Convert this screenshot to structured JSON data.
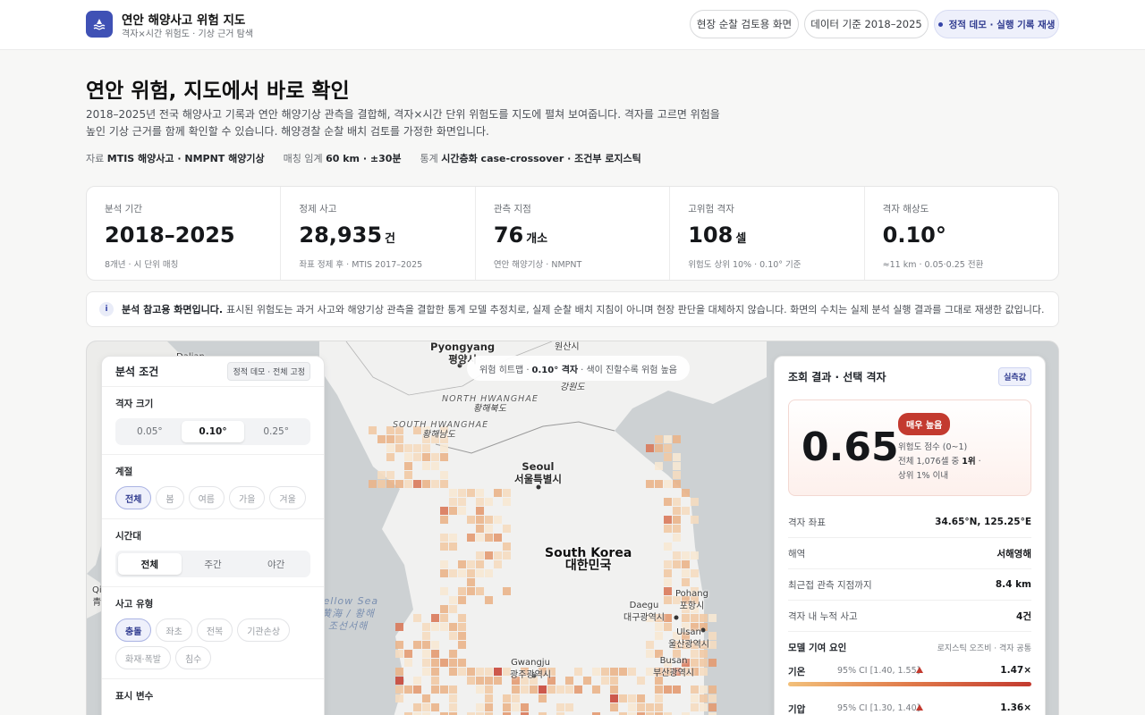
{
  "header": {
    "title": "연안 해양사고 위험 지도",
    "subtitle": "격자×시간 위험도 · 기상 근거 탐색",
    "buttons": [
      {
        "label": "현장 순찰 검토용 화면"
      },
      {
        "label": "데이터 기준 2018–2025"
      },
      {
        "label": "정적 데모 · 실행 기록 재생"
      }
    ]
  },
  "hero": {
    "title": "연안 위험, 지도에서 바로 확인",
    "description": "2018–2025년 전국 해양사고 기록과 연안 해양기상 관측을 결합해, 격자×시간 단위 위험도를 지도에 펼쳐 보여줍니다. 격자를 고르면 위험을 높인 기상 근거를 함께 확인할 수 있습니다. 해양경찰 순찰 배치 검토를 가정한 화면입니다.",
    "meta": {
      "data_label": "자료",
      "data_value": "MTIS 해양사고 · NMPNT 해양기상",
      "match_label": "매칭 임계",
      "match_value": "60 km · ±30분",
      "stats_label": "통계",
      "stats_value": "시간층화 case-crossover · 조건부 로지스틱"
    }
  },
  "stats": [
    {
      "label": "분석 기간",
      "value": "2018–2025",
      "unit": "",
      "sub": "8개년 · 시 단위 매칭"
    },
    {
      "label": "정제 사고",
      "value": "28,935",
      "unit": "건",
      "sub": "좌표 정제 후 · MTIS 2017–2025"
    },
    {
      "label": "관측 지점",
      "value": "76",
      "unit": "개소",
      "sub": "연안 해양기상 · NMPNT"
    },
    {
      "label": "고위험 격자",
      "value": "108",
      "unit": "셀",
      "sub": "위험도 상위 10% · 0.10° 기준"
    },
    {
      "label": "격자 해상도",
      "value": "0.10°",
      "unit": "",
      "sub": "≈11 km · 0.05·0.25 전환"
    }
  ],
  "notice": {
    "icon": "info-icon",
    "bold": "분석 참고용 화면입니다.",
    "text": "표시된 위험도는 과거 사고와 해양기상 관측을 결합한 통계 모델 추정치로, 실제 순찰 배치 지침이 아니며 현장 판단을 대체하지 않습니다. 화면의 수치는 실제 분석 실행 결과를 그대로 재생한 값입니다."
  },
  "map": {
    "hint_prefix": "위험 히트맵 ·",
    "hint_bold": "0.10° 격자",
    "hint_suffix": "· 색이 진할수록 위험 높음",
    "labels": {
      "dalian": "Dalian",
      "pyongyang": "Pyongyang\n평양시",
      "wonsan": "원산시",
      "gangwon": "강원도",
      "north_hwanghae": "NORTH HWANGHAE",
      "north_hwanghae_ko": "황해북도",
      "south_hwanghae": "SOUTH HWANGHAE",
      "south_hwanghae_ko": "황해남도",
      "seoul": "Seoul\n서울특별시",
      "south_korea": "South Korea\n대한민국",
      "yellow_sea": "Yellow Sea\n黄海 / 황해\n조선서해",
      "qingdao": "Qi\n青",
      "daegu": "Daegu\n대구광역시",
      "pohang": "Pohang\n포항시",
      "ulsan": "Ulsan\n울산광역시",
      "busan": "Busan\n부산광역시",
      "gwangju": "Gwangju\n광주광역시"
    }
  },
  "filters": {
    "title": "분석 조건",
    "tag": "정적 데모 · 전체 고정",
    "grid_size": {
      "title": "격자 크기",
      "options": [
        "0.05°",
        "0.10°",
        "0.25°"
      ],
      "selected": "0.10°"
    },
    "season": {
      "title": "계절",
      "options": [
        "전체",
        "봄",
        "여름",
        "가을",
        "겨울"
      ],
      "selected": "전체"
    },
    "time_of_day": {
      "title": "시간대",
      "options": [
        "전체",
        "주간",
        "야간"
      ],
      "selected": "전체"
    },
    "accident_type": {
      "title": "사고 유형",
      "options": [
        "충돌",
        "좌초",
        "전복",
        "기관손상",
        "화재·폭발",
        "침수"
      ],
      "selected": "충돌"
    },
    "display_var": {
      "title": "표시 변수"
    }
  },
  "result": {
    "title": "조회 결과 · 선택 격자",
    "tag": "실측값",
    "score": "0.65",
    "badge": "매우 높음",
    "score_label": "위험도 점수 (0~1)",
    "rank_prefix": "전체 1,076셀 중",
    "rank_value": "1위",
    "rank_suffix": "·",
    "rank_note": "상위 1% 이내",
    "rows": [
      {
        "key": "격자 좌표",
        "value": "34.65°N, 125.25°E"
      },
      {
        "key": "해역",
        "value": "서해영해"
      },
      {
        "key": "최근접 관측 지점까지",
        "value": "8.4 km"
      },
      {
        "key": "격자 내 누적 사고",
        "value": "4건"
      }
    ],
    "contrib_title": "모델 기여 요인",
    "contrib_note": "로지스틱 오즈비 · 격자 공통",
    "factors": [
      {
        "name": "기온",
        "ci": "95% CI [1.40, 1.55]",
        "value": "1.47×",
        "level": 1.0
      },
      {
        "name": "기압",
        "ci": "95% CI [1.30, 1.40]",
        "value": "1.36×",
        "level": 0.8
      }
    ]
  },
  "colors": {
    "accent": "#3f51b5",
    "risk_high": "#c33a2f",
    "heat_low": "#f6e3c8",
    "heat_high": "#c9473a"
  }
}
